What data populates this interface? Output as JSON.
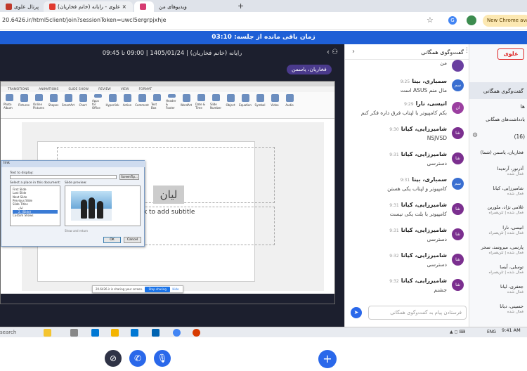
{
  "browser": {
    "tabs": [
      {
        "label": "پرتال علوی"
      },
      {
        "label": "علوی - رایانه (خانم فخاریان) ×"
      },
      {
        "label": ""
      },
      {
        "label": "ویدیوهای من"
      }
    ],
    "url": "20.6426.ir/html5client/join?sessionToken=uwcl5ergrpjxhje",
    "new_chrome": "New Chrome availa"
  },
  "timer": "زمان باقی مانده از جلسه: 03:10",
  "meeting": {
    "title": "رایانه (خانم فخاریان) | 1405/01/24 | 09:00 تا 09:45",
    "presenter": "فخاریان، یاسمن"
  },
  "slide": {
    "subtitle": "ck to add subtitle",
    "word": "لیان",
    "ribbon_tabs": [
      "TRANSITIONS",
      "ANIMATIONS",
      "SLIDE SHOW",
      "REVIEW",
      "VIEW",
      "FORMAT"
    ],
    "ribbon_buttons": [
      "Photo Album",
      "Pictures",
      "Online Pictures",
      "Shapes",
      "SmartArt",
      "Chart",
      "Apps for Office",
      "Hyperlink",
      "Action",
      "Comment",
      "Text Box",
      "Header & Footer",
      "WordArt",
      "Date & Time",
      "Slide Number",
      "Object",
      "Equation",
      "Symbol",
      "Video",
      "Audio"
    ]
  },
  "dialog": {
    "title": "link",
    "text_label": "Text to display:",
    "browse": "ScreenTip...",
    "place_label": "Select a place in this document:",
    "preview_label": "Slide preview:",
    "items": [
      "First Slide",
      "Last Slide",
      "Next Slide",
      "Previous Slide",
      "Slide Titles",
      "لیان",
      "2. (Slide)",
      "Custom Shows"
    ],
    "checkbox": "Show and return",
    "ok": "OK",
    "cancel": "Cancel"
  },
  "sharebar": {
    "text": "20.6426.ir is sharing your screen.",
    "stop": "Stop sharing",
    "hide": "Hide"
  },
  "chat": {
    "header": "گفت‌وگوی همگانی",
    "input_placeholder": "فرستادن پیام به گفت‌وگوی همگانی",
    "messages": [
      {
        "name": "",
        "time": "",
        "text": "من",
        "avatar": "",
        "color": "#6a3fa0"
      },
      {
        "name": "سمباری، بینا",
        "time": "9:25",
        "text": "مال منم ASUS است",
        "avatar": "سم",
        "color": "#3a6fd1"
      },
      {
        "name": "انیسی، نارا",
        "time": "9:29",
        "text": "بکم کامپیوتر با لپتاب فرق داره فکر کنم",
        "avatar": "ان",
        "color": "#9b3fa0"
      },
      {
        "name": "شامیرزایی، کیانا",
        "time": "9:30",
        "text": "NSJVSD",
        "avatar": "شا",
        "color": "#7b2f8f"
      },
      {
        "name": "شامیرزایی، کیانا",
        "time": "9:31",
        "text": "دسترسی",
        "avatar": "شا",
        "color": "#7b2f8f"
      },
      {
        "name": "سمباری، بینا",
        "time": "9:31",
        "text": "کامپیوتر و لپتاب یکی هستن",
        "avatar": "سم",
        "color": "#3a6fd1"
      },
      {
        "name": "شامیرزایی، کیانا",
        "time": "9:31",
        "text": "کامپیوتر با بلت یکی نیست",
        "avatar": "شا",
        "color": "#7b2f8f"
      },
      {
        "name": "شامیرزایی، کیانا",
        "time": "9:31",
        "text": "دسترسی",
        "avatar": "شا",
        "color": "#7b2f8f"
      },
      {
        "name": "شامیرزایی، کیانا",
        "time": "9:32",
        "text": "دسترسی",
        "avatar": "شا",
        "color": "#7b2f8f"
      },
      {
        "name": "شامیرزایی، کیانا",
        "time": "9:32",
        "text": "جشنم",
        "avatar": "شا",
        "color": "#7b2f8f"
      }
    ]
  },
  "sidebar": {
    "logo": "علوی",
    "nav_chat": "گفت‌وگوی همگانی",
    "nav_notes": "ها",
    "nav_shared": "یادداشت‌های همگانی",
    "user_count": "(16)",
    "users": [
      {
        "name": "فخاریان، یاسمن (شما)",
        "sub": ""
      },
      {
        "name": "آذرنور، آرتدیدا",
        "sub": "فعال شده"
      },
      {
        "name": "شامیرزایی، کیانا",
        "sub": "فعال شده"
      },
      {
        "name": "غلامی نژاد، ملورین",
        "sub": "فعال شده | تلن‌همراه"
      },
      {
        "name": "انیسی، نارا",
        "sub": "فعال شده | تلن‌همراه"
      },
      {
        "name": "پارسی، میروسد، سحر",
        "sub": "فعال شده | تلن‌همراه"
      },
      {
        "name": "توسلی، آیسا",
        "sub": "فعال شده | تلن‌همراه"
      },
      {
        "name": "جعفری، لیانا",
        "sub": "فعال شده"
      },
      {
        "name": "حسینی، دیانا",
        "sub": "فعال شده"
      }
    ]
  },
  "taskbar": {
    "search": "search",
    "time": "9:41 AM",
    "lang": "ENG",
    "tray": "▲ ◻ ⌨"
  }
}
